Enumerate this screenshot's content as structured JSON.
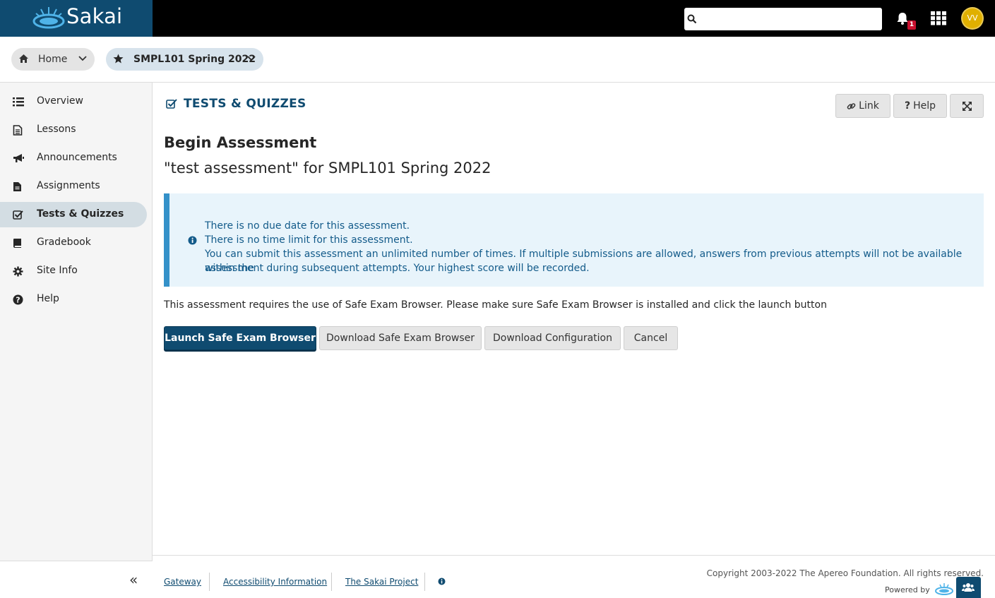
{
  "header": {
    "logo_text": "Sakai",
    "search_placeholder": "",
    "notification_count": "1",
    "avatar_initials": "VV"
  },
  "breadcrumbs": {
    "home_label": "Home",
    "site_label": "SMPL101 Spring 2022"
  },
  "sidebar": {
    "items": [
      {
        "label": "Overview",
        "icon": "list-icon"
      },
      {
        "label": "Lessons",
        "icon": "file-text-icon"
      },
      {
        "label": "Announcements",
        "icon": "bullhorn-icon"
      },
      {
        "label": "Assignments",
        "icon": "file-icon"
      },
      {
        "label": "Tests & Quizzes",
        "icon": "check-square-icon",
        "active": true
      },
      {
        "label": "Gradebook",
        "icon": "book-icon"
      },
      {
        "label": "Site Info",
        "icon": "gear-icon"
      },
      {
        "label": "Help",
        "icon": "question-circle-icon"
      }
    ],
    "collapse_glyph": "«"
  },
  "tool": {
    "title": "TESTS & QUIZZES",
    "link_label": "Link",
    "help_label": "Help"
  },
  "main": {
    "heading": "Begin Assessment",
    "subheading": "\"test assessment\" for SMPL101 Spring 2022",
    "info_lines": [
      "There is no due date for this assessment.",
      "There is no time limit for this assessment.",
      "You can submit this assessment an unlimited number of times. If multiple submissions are allowed, answers from previous attempts will not be available within the",
      "assessment during subsequent attempts. Your highest score will be recorded."
    ],
    "requirement_text": "This assessment requires the use of Safe Exam Browser. Please make sure Safe Exam Browser is installed and click the launch button",
    "buttons": {
      "launch": "Launch Safe Exam Browser",
      "download_seb": "Download Safe Exam Browser",
      "download_config": "Download Configuration",
      "cancel": "Cancel"
    }
  },
  "footer": {
    "links": [
      "Gateway",
      "Accessibility Information",
      "The Sakai Project"
    ],
    "copyright": "Copyright 2003-2022 The Apereo Foundation. All rights reserved.",
    "powered_by": "Powered by"
  },
  "colors": {
    "brand": "#0f4b70",
    "info_bg": "#e8f4fb",
    "info_border": "#3491c9",
    "active_nav": "#d3dde3"
  }
}
